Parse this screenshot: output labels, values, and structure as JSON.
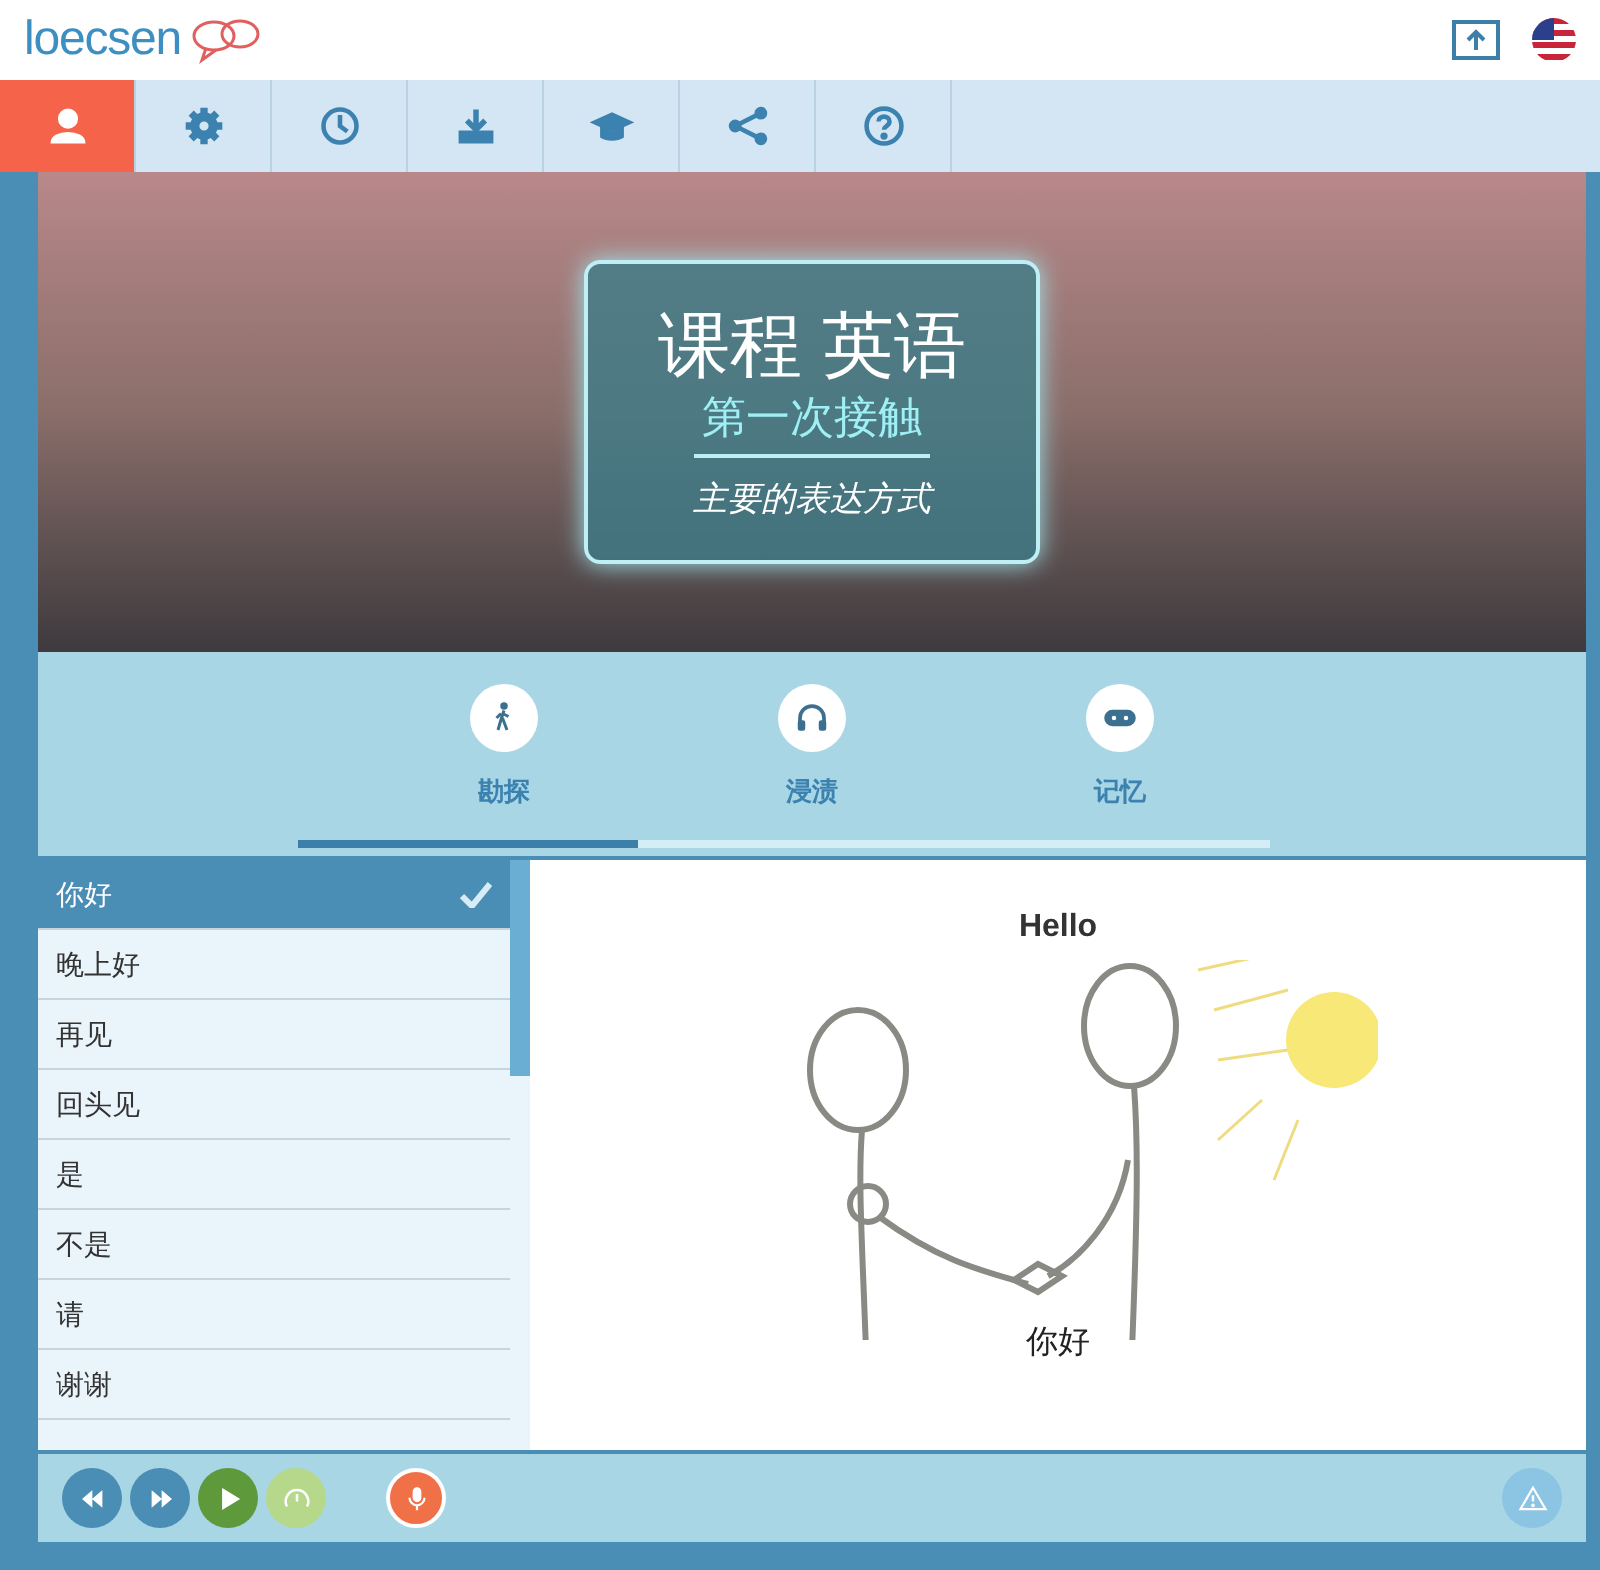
{
  "header": {
    "logo": "loecsen"
  },
  "nav_tabs": [
    {
      "kind": "person",
      "selected": true
    },
    {
      "kind": "gear",
      "selected": false
    },
    {
      "kind": "clock",
      "selected": false
    },
    {
      "kind": "download",
      "selected": false
    },
    {
      "kind": "cap",
      "selected": false
    },
    {
      "kind": "share",
      "selected": false
    },
    {
      "kind": "help",
      "selected": false
    }
  ],
  "banner": {
    "title": "课程 英语",
    "subtitle": "第一次接触",
    "caption": "主要的表达方式"
  },
  "modes": [
    {
      "kind": "walk",
      "label": "勘探"
    },
    {
      "kind": "headphones",
      "label": "浸渍"
    },
    {
      "kind": "gamepad",
      "label": "记忆"
    }
  ],
  "progress": {
    "level": 0.35
  },
  "phrases": [
    {
      "text": "你好",
      "selected": true
    },
    {
      "text": "晚上好",
      "selected": false
    },
    {
      "text": "再见",
      "selected": false
    },
    {
      "text": "回头见",
      "selected": false
    },
    {
      "text": "是",
      "selected": false
    },
    {
      "text": "不是",
      "selected": false
    },
    {
      "text": "请",
      "selected": false
    },
    {
      "text": "谢谢",
      "selected": false
    }
  ],
  "card": {
    "title": "Hello",
    "caption": "你好"
  },
  "controls": [
    {
      "kind": "rewind"
    },
    {
      "kind": "forward"
    },
    {
      "kind": "play"
    },
    {
      "kind": "speed"
    },
    {
      "kind": "mic"
    },
    {
      "kind": "report"
    }
  ]
}
